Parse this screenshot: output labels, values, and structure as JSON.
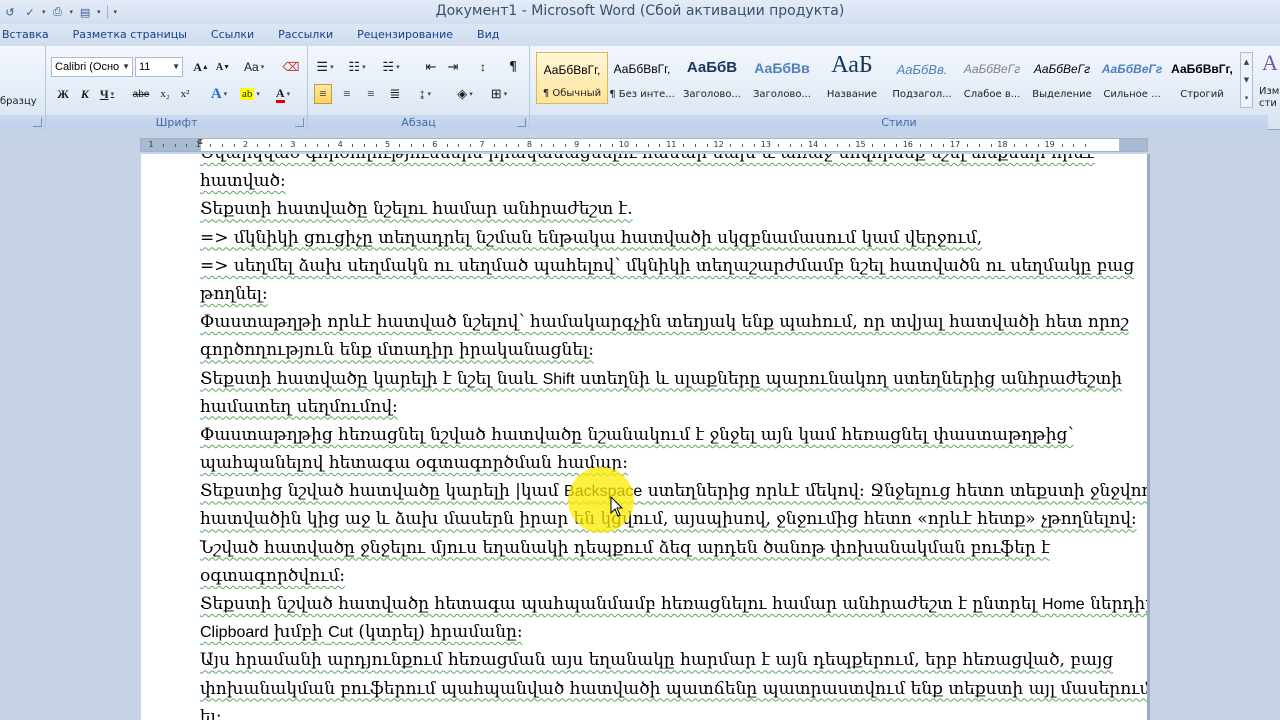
{
  "window": {
    "title": "Документ1  -  Microsoft Word (Сбой активации продукта)"
  },
  "tabs": [
    "Вставка",
    "Разметка страницы",
    "Ссылки",
    "Рассылки",
    "Рецензирование",
    "Вид"
  ],
  "left_edge_fragment": "бразцу",
  "font_group": {
    "label": "Шрифт",
    "font_name": "Calibri (Осно",
    "font_size": "11",
    "grow": "A",
    "shrink": "A",
    "case": "Aa",
    "bold": "Ж",
    "italic": "К",
    "underline": "Ч",
    "strike": "abe",
    "subscript": "x₂",
    "superscript": "x²"
  },
  "paragraph_group": {
    "label": "Абзац"
  },
  "styles_group": {
    "label": "Стили",
    "items": [
      {
        "sample": "АаБбВвГг,",
        "name": "¶ Обычный",
        "color": "#000000"
      },
      {
        "sample": "АаБбВвГг,",
        "name": "¶ Без инте...",
        "color": "#000000"
      },
      {
        "sample": "АаБбВ",
        "name": "Заголово...",
        "color": "#17365d"
      },
      {
        "sample": "АаБбВв",
        "name": "Заголово...",
        "color": "#4f81bd"
      },
      {
        "sample": "АаБ",
        "name": "Название",
        "color": "#17365d"
      },
      {
        "sample": "АаБбВв.",
        "name": "Подзагол...",
        "color": "#4f81bd"
      },
      {
        "sample": "АаБбВеГг",
        "name": "Слабое в...",
        "color": "#808080"
      },
      {
        "sample": "АаБбВеГг",
        "name": "Выделение",
        "color": "#000000"
      },
      {
        "sample": "АаБбВеГг",
        "name": "Сильное ...",
        "color": "#4f81bd"
      },
      {
        "sample": "АаБбВвГг,",
        "name": "Строгий",
        "color": "#000000"
      }
    ],
    "right_fragment_1": "Изм",
    "right_fragment_2": "сти"
  },
  "ruler": {
    "numbers": [
      "1",
      "1",
      "2",
      "3",
      "4",
      "5",
      "6",
      "7",
      "8",
      "9",
      "10",
      "11",
      "12",
      "13",
      "14",
      "15",
      "16",
      "17",
      "18",
      "19"
    ]
  },
  "document": {
    "lines": [
      [
        {
          "t": "Ծվարկված գործողություններն իրականացնելու համար նախ և առաջ սովորենք նշել տեքստի  որևէ"
        }
      ],
      [
        {
          "t": "հատված:"
        }
      ],
      [
        {
          "t": "Տեքստի հատվածը նշելու համար անհրաժեշտ է."
        }
      ],
      [
        {
          "t": "=> մկնիկի ցուցիչը տեղադրել նշման ենթակա հատվածի սկզբնամասում կամ վերջում,"
        }
      ],
      [
        {
          "t": "=> սեղմել ձախ սեղմակն ու սեղմած պահելով՝ մկնիկի տեղաշարժմամբ նշել հատվածն ու սեղմակը բաց"
        }
      ],
      [
        {
          "t": "թողնել:"
        }
      ],
      [
        {
          "t": "Փաստաթղթի որևէ հատված նշելով՝ համակարգչին տեղյակ ենք պահում, որ տվյալ հատվածի հետ որոշ"
        }
      ],
      [
        {
          "t": "գործողություն ենք մտադիր իրականացնել:"
        }
      ],
      [
        {
          "t": "Տեքստի հատվածը կարելի է նշել նաև "
        },
        {
          "t": "Shift",
          "latin": true
        },
        {
          "t": " ստեղնի և  սլաքները պարունակող ստեղներից անհրաժեշտի"
        }
      ],
      [
        {
          "t": "համատեղ սեղմումով:"
        }
      ],
      [
        {
          "t": "Փաստաթղթից հեռացնել նշված հատվածը  նշանակում է ջնջել այն կամ հեռացնել փաստաթղթից՝"
        }
      ],
      [
        {
          "t": "պահպանելով հետագա օգտագործման համար:"
        }
      ],
      [
        {
          "t": "Տեքստից նշված հատվածը կարելի |կամ  "
        },
        {
          "t": "Backspace",
          "latin": true
        },
        {
          "t": " ստեղներից որևէ մեկով: Ջնջելուց հետո տեքստի ջնջվող"
        }
      ],
      [
        {
          "t": "հատվածին կից աջ և ձախ մասերն իրար են կցվում, այսպիսով, ջնջումից հետո «որևէ հետք» չթողնելով:"
        }
      ],
      [
        {
          "t": "Նշված հատվածը ջնջելու մյուս եղանակի դեպքում ձեզ արդեն ծանոթ փոխանակման բուֆեր է"
        }
      ],
      [
        {
          "t": "օգտագործվում:"
        }
      ],
      [
        {
          "t": "Տեքստի նշված հատվածը հետագա պահպանմամբ հեռացնելու համար անհրաժեշտ է ընտրել "
        },
        {
          "t": "Home",
          "latin": true
        },
        {
          "t": "  ներդիրի"
        }
      ],
      [
        {
          "t": "Clipboard",
          "latin": true
        },
        {
          "t": " խմբի "
        },
        {
          "t": "Cut",
          "latin": true
        },
        {
          "t": " (կտրել) հրամանը:"
        }
      ],
      [
        {
          "t": "Այս հրամանի արդյունքում հեռացման այս եղանակը հարմար է այն դեպքերում, երբ հեռացված, բայց"
        }
      ],
      [
        {
          "t": "փոխանակման բուֆերում պահպանված հատվածի պատճենը պատրաստվում ենք տեքստի այլ մասերում"
        }
      ],
      [
        {
          "t": "                   ել:"
        }
      ]
    ]
  }
}
